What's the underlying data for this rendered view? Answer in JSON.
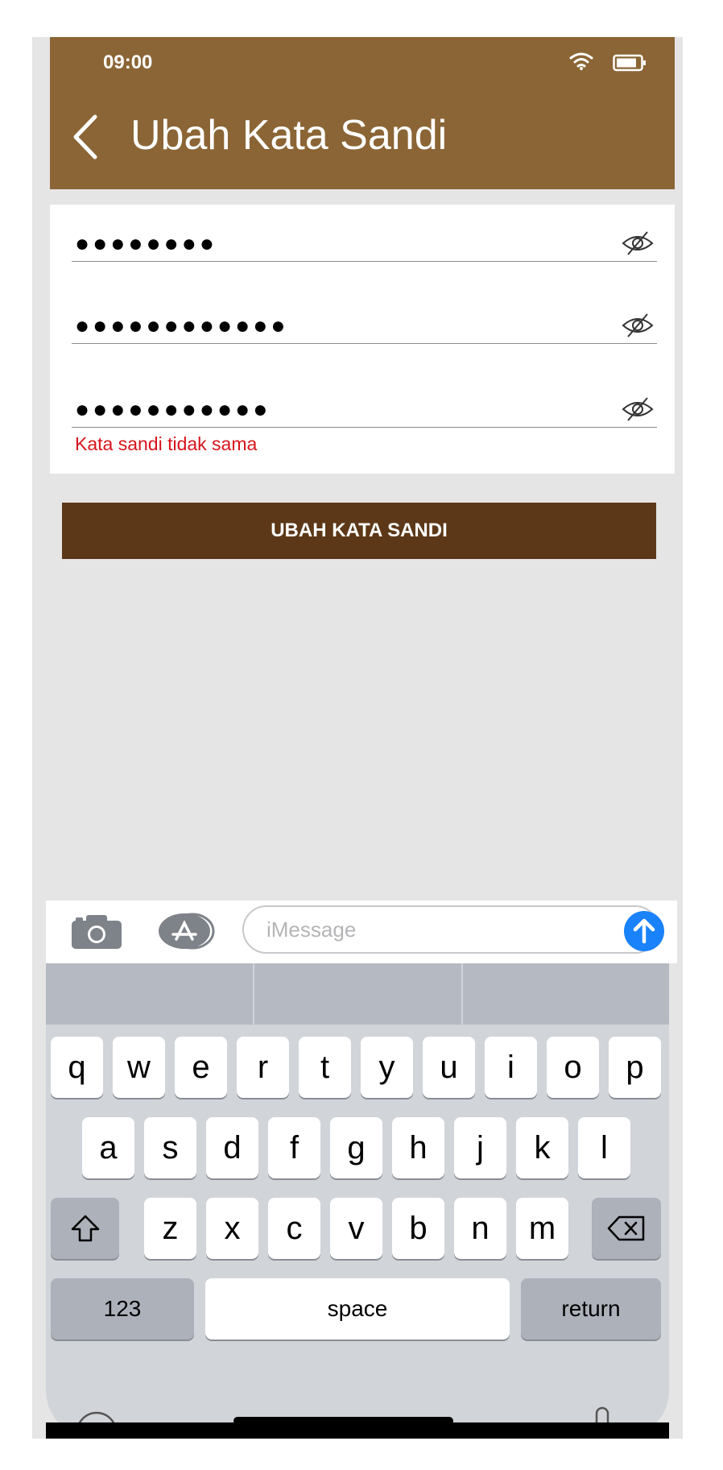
{
  "status_bar": {
    "time": "09:00"
  },
  "header": {
    "title": "Ubah Kata Sandi"
  },
  "form": {
    "fields": [
      {
        "masked_value": "●●●●●●●●"
      },
      {
        "masked_value": "●●●●●●●●●●●●"
      },
      {
        "masked_value": "●●●●●●●●●●●"
      }
    ],
    "error": "Kata sandi tidak sama",
    "submit_label": "UBAH KATA SANDI"
  },
  "message_bar": {
    "placeholder": "iMessage"
  },
  "keyboard": {
    "row1": [
      "q",
      "w",
      "e",
      "r",
      "t",
      "y",
      "u",
      "i",
      "o",
      "p"
    ],
    "row2": [
      "a",
      "s",
      "d",
      "f",
      "g",
      "h",
      "j",
      "k",
      "l"
    ],
    "row3": [
      "z",
      "x",
      "c",
      "v",
      "b",
      "n",
      "m"
    ],
    "numbers_label": "123",
    "space_label": "space",
    "return_label": "return"
  },
  "colors": {
    "header": "#8b6535",
    "button": "#5c3818",
    "error": "#d7141b",
    "send": "#1a82fb"
  }
}
